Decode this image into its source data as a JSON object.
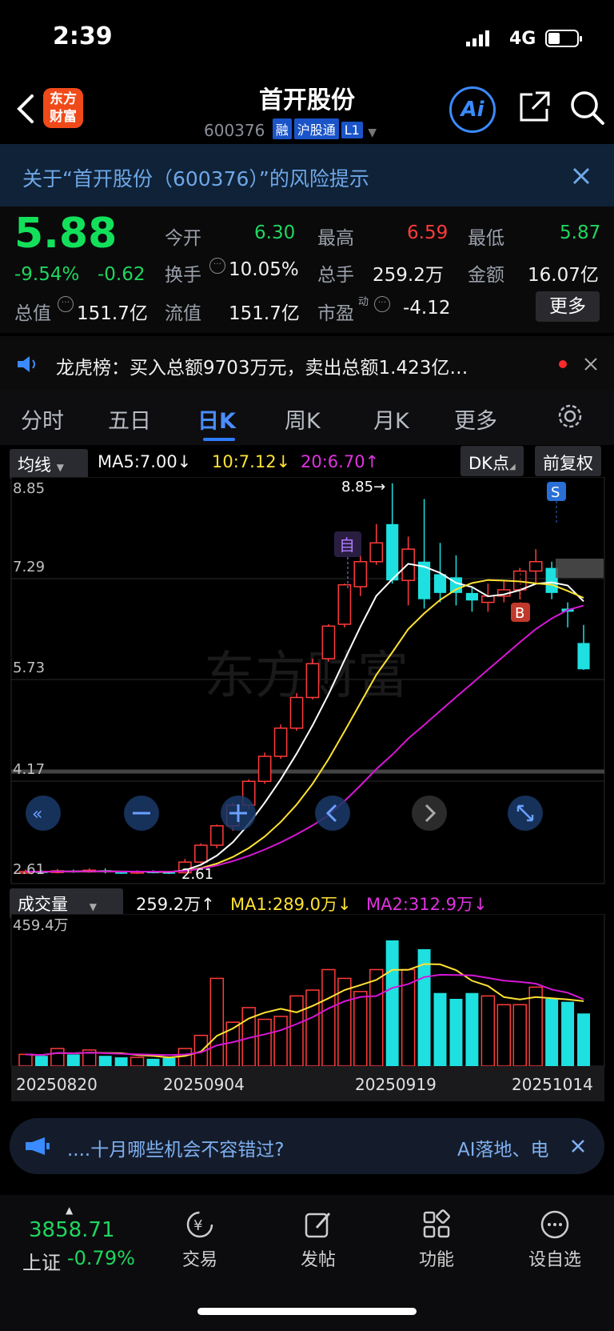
{
  "status": {
    "time": "2:39",
    "network": "4G"
  },
  "header": {
    "title": "首开股份",
    "code": "600376",
    "tags": [
      "融",
      "沪股通",
      "L1"
    ],
    "logo_text": "东方财富",
    "ai_label": "Ai"
  },
  "risk_banner": "关于“首开股份（600376）”的风险提示",
  "quote": {
    "price": "5.88",
    "change_pct": "-9.54%",
    "change": "-0.62",
    "open_label": "今开",
    "open": "6.30",
    "high_label": "最高",
    "high": "6.59",
    "low_label": "最低",
    "low": "5.87",
    "turnover_label": "换手",
    "turnover": "10.05%",
    "volume_label": "总手",
    "volume": "259.2万",
    "amount_label": "金额",
    "amount": "16.07亿",
    "total_cap_label": "总值",
    "total_cap": "151.7亿",
    "float_cap_label": "流值",
    "float_cap": "151.7亿",
    "pe_label": "市盈",
    "pe_sup": "动",
    "pe": "-4.12",
    "more_label": "更多"
  },
  "dragon_tiger": "龙虎榜：买入总额9703万元，卖出总额1.423亿…",
  "tabs": [
    "分时",
    "五日",
    "日K",
    "周K",
    "月K",
    "更多"
  ],
  "chart_controls": {
    "ma_select": "均线",
    "ma5": "MA5:7.00↓",
    "ma10": "10:7.12↓",
    "ma20": "20:6.70↑",
    "dk": "DK点",
    "fq": "前复权"
  },
  "price_axis": [
    "8.85",
    "7.29",
    "5.73",
    "4.17",
    "2.61"
  ],
  "annotations": {
    "high_label": "8.85→",
    "low_label": "2.61",
    "mark_zi": "自",
    "mark_s": "S",
    "mark_b": "B",
    "watermark": "东方财富"
  },
  "volume_controls": {
    "select": "成交量",
    "vol": "259.2万↑",
    "ma1": "MA1:289.0万↓",
    "ma2": "MA2:312.9万↓",
    "axis_max": "459.4万"
  },
  "dates": [
    "20250820",
    "20250904",
    "20250919",
    "20251014"
  ],
  "promo": {
    "text": "....十月哪些机会不容错过?",
    "right": "AI落地、电"
  },
  "bottom_nav": {
    "index_value": "3858.71",
    "index_name": "上证",
    "index_change": "-0.79%",
    "items": [
      "交易",
      "发帖",
      "功能",
      "设自选"
    ]
  },
  "colors": {
    "up": "#ff3b3b",
    "down": "#1fe0e0",
    "green": "#1fd65f",
    "ma5": "#ffffff",
    "ma10": "#ffe233",
    "ma20": "#d616d6"
  },
  "chart_data": {
    "type": "candlestick",
    "dates_shown": [
      "20250820",
      "20250904",
      "20250919",
      "20251014"
    ],
    "candles": [
      {
        "o": 2.63,
        "c": 2.65,
        "h": 2.68,
        "l": 2.61
      },
      {
        "o": 2.65,
        "c": 2.64,
        "h": 2.67,
        "l": 2.62
      },
      {
        "o": 2.64,
        "c": 2.66,
        "h": 2.69,
        "l": 2.62
      },
      {
        "o": 2.66,
        "c": 2.65,
        "h": 2.68,
        "l": 2.63
      },
      {
        "o": 2.65,
        "c": 2.67,
        "h": 2.7,
        "l": 2.63
      },
      {
        "o": 2.67,
        "c": 2.64,
        "h": 2.7,
        "l": 2.62
      },
      {
        "o": 2.64,
        "c": 2.63,
        "h": 2.66,
        "l": 2.61
      },
      {
        "o": 2.63,
        "c": 2.65,
        "h": 2.67,
        "l": 2.61
      },
      {
        "o": 2.65,
        "c": 2.64,
        "h": 2.67,
        "l": 2.62
      },
      {
        "o": 2.64,
        "c": 2.63,
        "h": 2.66,
        "l": 2.61
      },
      {
        "o": 2.63,
        "c": 2.8,
        "h": 2.85,
        "l": 2.62
      },
      {
        "o": 2.8,
        "c": 3.07,
        "h": 3.1,
        "l": 2.78
      },
      {
        "o": 3.07,
        "c": 3.38,
        "h": 3.4,
        "l": 3.02
      },
      {
        "o": 3.38,
        "c": 3.71,
        "h": 3.75,
        "l": 3.3
      },
      {
        "o": 3.71,
        "c": 4.09,
        "h": 4.12,
        "l": 3.65
      },
      {
        "o": 4.09,
        "c": 4.49,
        "h": 4.55,
        "l": 4.05
      },
      {
        "o": 4.49,
        "c": 4.94,
        "h": 5.0,
        "l": 4.45
      },
      {
        "o": 4.94,
        "c": 5.43,
        "h": 5.5,
        "l": 4.9
      },
      {
        "o": 5.43,
        "c": 5.97,
        "h": 6.05,
        "l": 5.4
      },
      {
        "o": 6.05,
        "c": 6.57,
        "h": 6.6,
        "l": 6.0
      },
      {
        "o": 6.6,
        "c": 7.23,
        "h": 7.25,
        "l": 6.55
      },
      {
        "o": 7.2,
        "c": 7.6,
        "h": 7.9,
        "l": 7.05
      },
      {
        "o": 7.6,
        "c": 7.9,
        "h": 8.2,
        "l": 7.55
      },
      {
        "o": 8.2,
        "c": 7.3,
        "h": 8.85,
        "l": 7.25
      },
      {
        "o": 7.3,
        "c": 7.8,
        "h": 8.0,
        "l": 6.9
      },
      {
        "o": 7.6,
        "c": 7.0,
        "h": 8.6,
        "l": 6.85
      },
      {
        "o": 7.4,
        "c": 7.1,
        "h": 7.9,
        "l": 6.95
      },
      {
        "o": 7.35,
        "c": 7.1,
        "h": 7.7,
        "l": 6.9
      },
      {
        "o": 7.1,
        "c": 6.98,
        "h": 7.2,
        "l": 6.8
      },
      {
        "o": 6.95,
        "c": 7.05,
        "h": 7.25,
        "l": 6.8
      },
      {
        "o": 7.05,
        "c": 7.15,
        "h": 7.3,
        "l": 6.95
      },
      {
        "o": 7.15,
        "c": 7.45,
        "h": 7.5,
        "l": 7.0
      },
      {
        "o": 7.45,
        "c": 7.6,
        "h": 7.8,
        "l": 7.25
      },
      {
        "o": 7.5,
        "c": 7.1,
        "h": 7.6,
        "l": 7.0
      },
      {
        "o": 6.85,
        "c": 6.8,
        "h": 6.95,
        "l": 6.55
      },
      {
        "o": 6.3,
        "c": 5.88,
        "h": 6.59,
        "l": 5.87
      }
    ],
    "ylim": [
      2.61,
      8.85
    ]
  }
}
